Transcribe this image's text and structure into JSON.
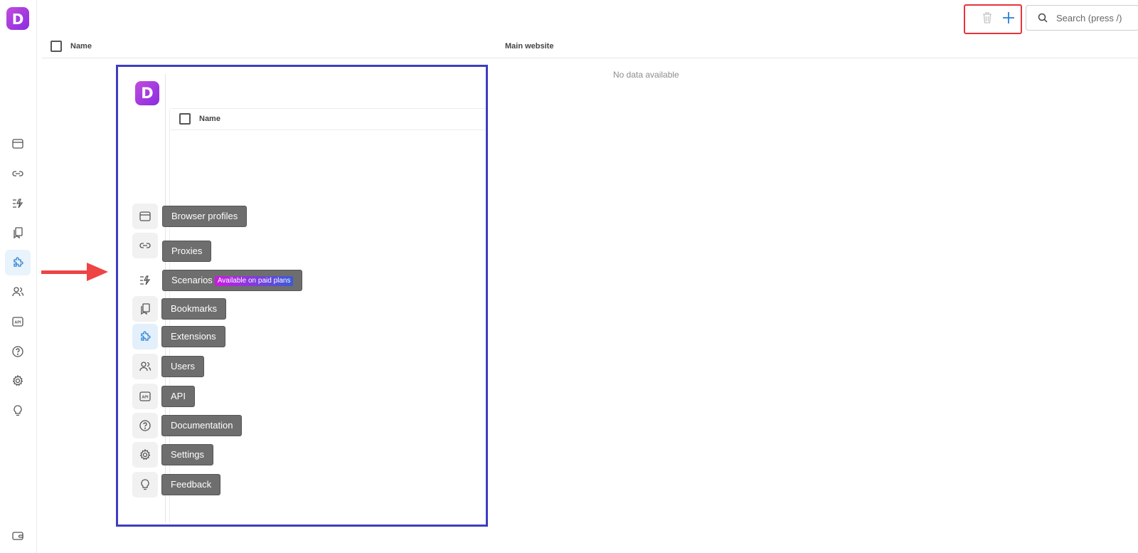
{
  "app": {
    "logo_letter": "D"
  },
  "topbar": {
    "search_placeholder": "Search (press /)"
  },
  "table": {
    "col_name": "Name",
    "col_main_website": "Main website",
    "empty_text": "No data available"
  },
  "panel": {
    "logo_letter": "D",
    "col_name": "Name",
    "items": [
      {
        "label": "Browser profiles",
        "icon": "browser-icon"
      },
      {
        "label": "Proxies",
        "icon": "link-icon"
      },
      {
        "label": "Scenarios",
        "icon": "scenario-icon",
        "badge": "Available on paid plans"
      },
      {
        "label": "Bookmarks",
        "icon": "bookmark-icon"
      },
      {
        "label": "Extensions",
        "icon": "puzzle-icon"
      },
      {
        "label": "Users",
        "icon": "users-icon"
      },
      {
        "label": "API",
        "icon": "api-icon"
      },
      {
        "label": "Documentation",
        "icon": "help-icon"
      },
      {
        "label": "Settings",
        "icon": "gear-icon"
      },
      {
        "label": "Feedback",
        "icon": "lightbulb-icon"
      }
    ]
  },
  "colors": {
    "accent": "#2a7fd4",
    "brand": "#a33be0",
    "highlight_red": "#e8333a",
    "highlight_blue": "#3d3dc2"
  }
}
